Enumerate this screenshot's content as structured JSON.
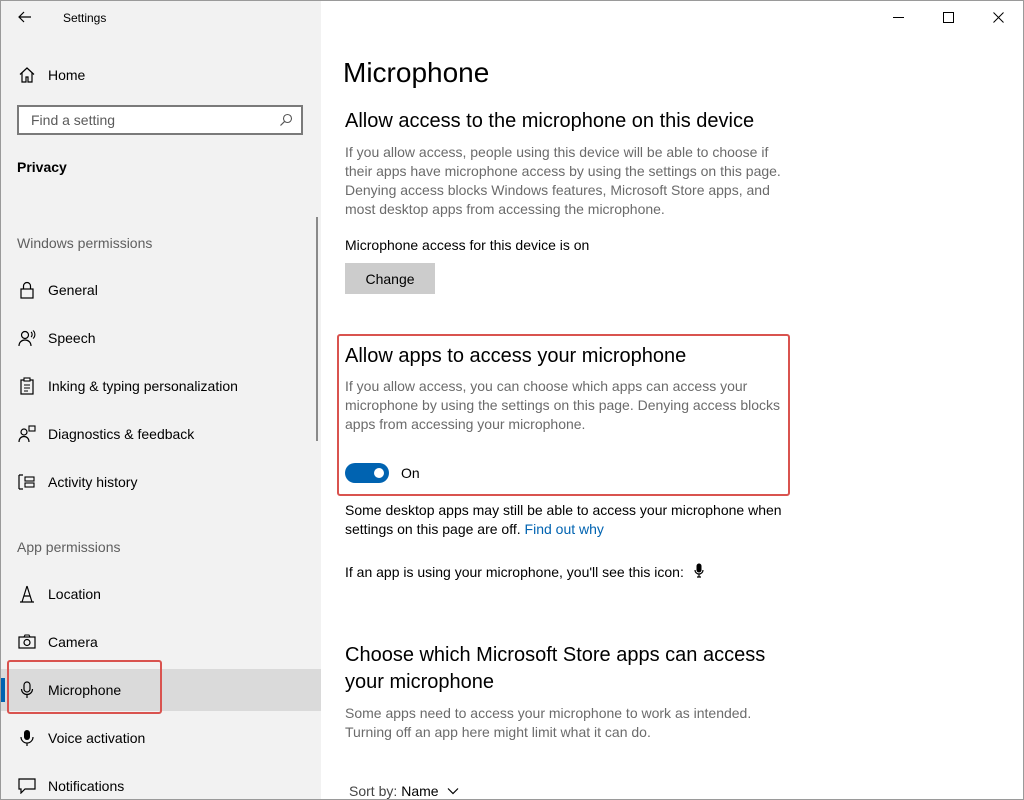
{
  "window": {
    "title": "Settings"
  },
  "sidebar": {
    "home_label": "Home",
    "search_placeholder": "Find a setting",
    "section_title": "Privacy",
    "windows_permissions_header": "Windows permissions",
    "windows_permissions": [
      {
        "label": "General",
        "icon": "lock-icon"
      },
      {
        "label": "Speech",
        "icon": "speech-person-icon"
      },
      {
        "label": "Inking & typing personalization",
        "icon": "clipboard-icon"
      },
      {
        "label": "Diagnostics & feedback",
        "icon": "person-feedback-icon"
      },
      {
        "label": "Activity history",
        "icon": "timeline-icon"
      }
    ],
    "app_permissions_header": "App permissions",
    "app_permissions": [
      {
        "label": "Location",
        "icon": "location-icon"
      },
      {
        "label": "Camera",
        "icon": "camera-icon"
      },
      {
        "label": "Microphone",
        "icon": "microphone-icon",
        "selected": true
      },
      {
        "label": "Voice activation",
        "icon": "voice-activation-icon"
      },
      {
        "label": "Notifications",
        "icon": "notifications-icon"
      }
    ]
  },
  "main": {
    "page_title": "Microphone",
    "device_section": {
      "heading": "Allow access to the microphone on this device",
      "description": "If you allow access, people using this device will be able to choose if their apps have microphone access by using the settings on this page. Denying access blocks Windows features, Microsoft Store apps, and most desktop apps from accessing the microphone.",
      "status": "Microphone access for this device is on",
      "change_button": "Change"
    },
    "apps_section": {
      "heading": "Allow apps to access your microphone",
      "description": "If you allow access, you can choose which apps can access your microphone by using the settings on this page. Denying access blocks apps from accessing your microphone.",
      "toggle_state": "On",
      "toggle_on": true
    },
    "desktop_note": {
      "text": "Some desktop apps may still be able to access your microphone when settings on this page are off.",
      "link": "Find out why"
    },
    "icon_note": "If an app is using your microphone, you'll see this icon:",
    "store_section": {
      "heading_line1": "Choose which Microsoft Store apps can access",
      "heading_line2": "your microphone",
      "description": "Some apps need to access your microphone to work as intended. Turning off an app here might limit what it can do."
    },
    "sort": {
      "label": "Sort by:",
      "value": "Name"
    }
  },
  "colors": {
    "accent": "#0063b1",
    "sidebar_bg": "#f2f2f2",
    "highlight_red": "#d9534f"
  }
}
